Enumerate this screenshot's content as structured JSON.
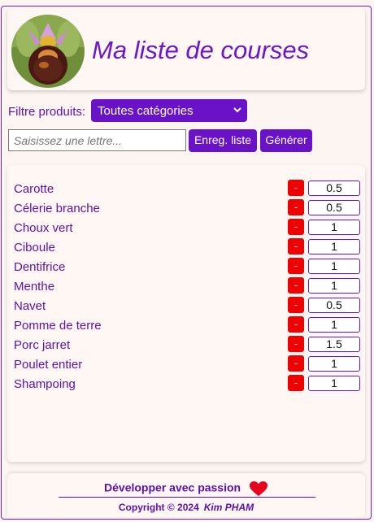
{
  "header": {
    "title": "Ma liste de courses",
    "logo_icon": "orchid-photo"
  },
  "filter": {
    "label": "Filtre produits:",
    "selected": "Toutes catégories"
  },
  "search": {
    "placeholder": "Saisissez une lettre..."
  },
  "toolbar": {
    "save_label": "Enreg. liste",
    "generate_label": "Générer"
  },
  "items": [
    {
      "name": "Carotte",
      "qty": "0.5"
    },
    {
      "name": "Célerie branche",
      "qty": "0.5"
    },
    {
      "name": "Choux vert",
      "qty": "1"
    },
    {
      "name": "Ciboule",
      "qty": "1"
    },
    {
      "name": "Dentifrice",
      "qty": "1"
    },
    {
      "name": "Menthe",
      "qty": "1"
    },
    {
      "name": "Navet",
      "qty": "0.5"
    },
    {
      "name": "Pomme de terre",
      "qty": "1"
    },
    {
      "name": "Porc jarret",
      "qty": "1.5"
    },
    {
      "name": "Poulet entier",
      "qty": "1"
    },
    {
      "name": "Shampoing",
      "qty": "1"
    }
  ],
  "remove_label": "-",
  "footer": {
    "tagline": "Développer avec passion",
    "copyright": "Copyright © 2024",
    "author": "Kim PHAM"
  },
  "colors": {
    "accent": "#6a12c8",
    "remove": "#f20000",
    "heart": "#e8001c"
  }
}
